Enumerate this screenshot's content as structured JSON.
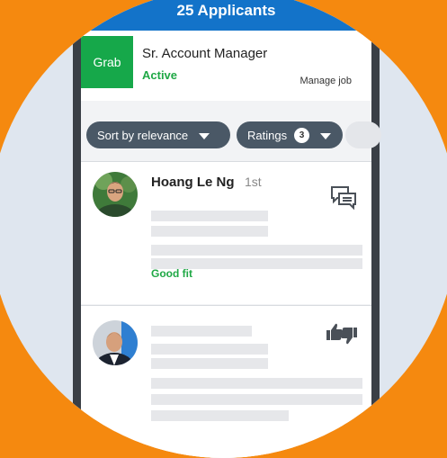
{
  "header": {
    "title": "25 Applicants"
  },
  "job": {
    "logo_text": "Grab",
    "title": "Sr. Account Manager",
    "status": "Active",
    "manage_label": "Manage job"
  },
  "filters": {
    "sort_label": "Sort by relevance",
    "ratings_label": "Ratings",
    "ratings_count": "3"
  },
  "applicants": [
    {
      "name": "Hoang Le Ng",
      "rank": "1st",
      "fit_label": "Good fit",
      "action_icon": "message-icon"
    },
    {
      "action_icon": "thumbs-up-down-icon"
    }
  ],
  "colors": {
    "background": "#f5890f",
    "circle": "#dfe6ef",
    "topbar": "#1373c9",
    "brand_green": "#16a84a",
    "active_green": "#1fa845",
    "pill": "#4a5866"
  }
}
